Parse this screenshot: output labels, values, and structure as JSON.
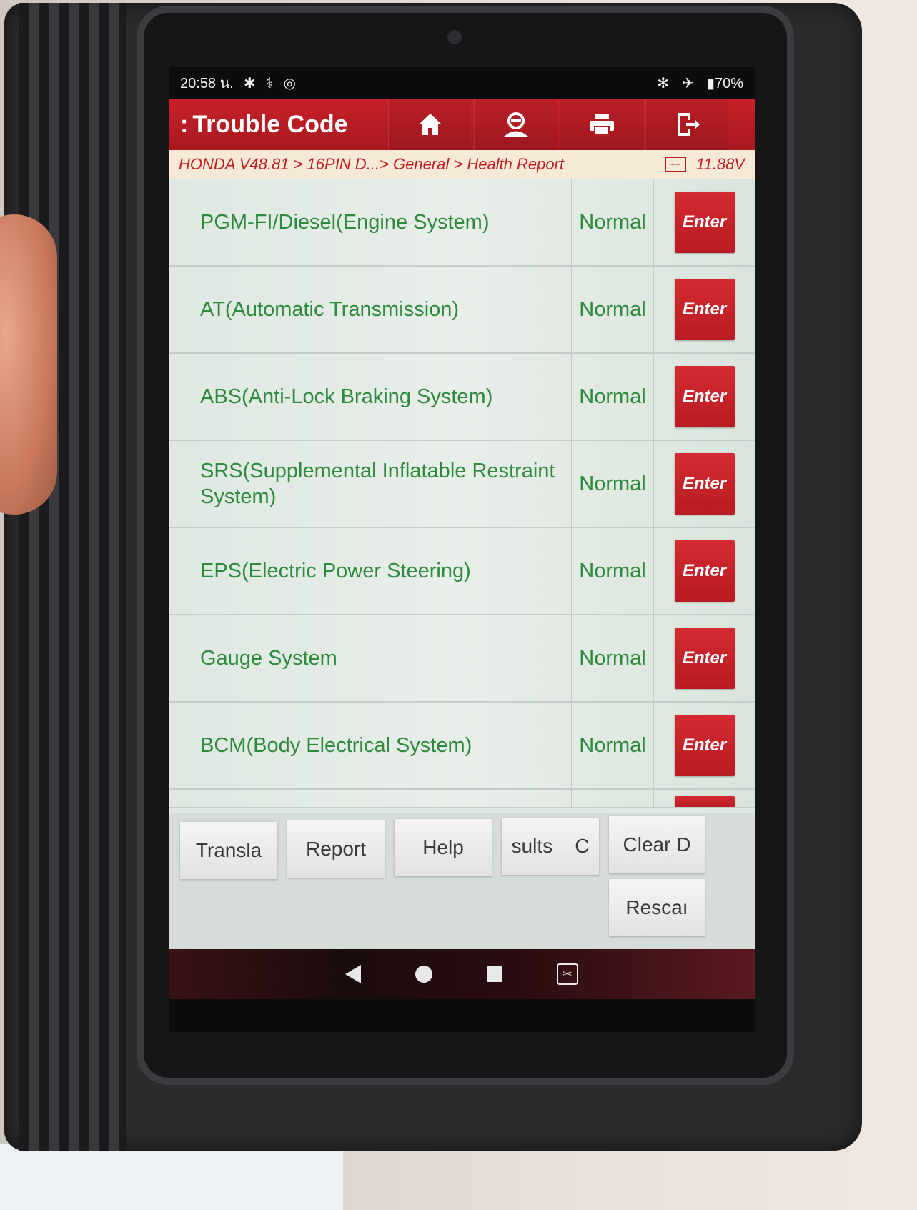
{
  "status_bar": {
    "time": "20:58 น.",
    "battery": "70%"
  },
  "header": {
    "back_glyph": ":",
    "title": "Trouble Code"
  },
  "icons": {
    "home": "home-icon",
    "user": "user-icon",
    "print": "print-icon",
    "exit": "exit-icon"
  },
  "breadcrumb": {
    "path": "HONDA V48.81 > 16PIN D...> General > Health Report",
    "voltage": "11.88V"
  },
  "systems": [
    {
      "name": "PGM-FI/Diesel(Engine System)",
      "status": "Normal",
      "action": "Enter"
    },
    {
      "name": "AT(Automatic Transmission)",
      "status": "Normal",
      "action": "Enter"
    },
    {
      "name": "ABS(Anti-Lock Braking System)",
      "status": "Normal",
      "action": "Enter"
    },
    {
      "name": "SRS(Supplemental Inflatable Restraint System)",
      "status": "Normal",
      "action": "Enter"
    },
    {
      "name": "EPS(Electric Power Steering)",
      "status": "Normal",
      "action": "Enter"
    },
    {
      "name": "Gauge System",
      "status": "Normal",
      "action": "Enter"
    },
    {
      "name": "BCM(Body Electrical System)",
      "status": "Normal",
      "action": "Enter"
    }
  ],
  "bottom_buttons": {
    "translate": "Transla",
    "report": "Report",
    "help": "Help",
    "results": "sults    C",
    "clear": "Clear D",
    "rescan": "Rescaı"
  },
  "colors": {
    "accent_red": "#c31c22",
    "text_green": "#2e8a3c"
  }
}
